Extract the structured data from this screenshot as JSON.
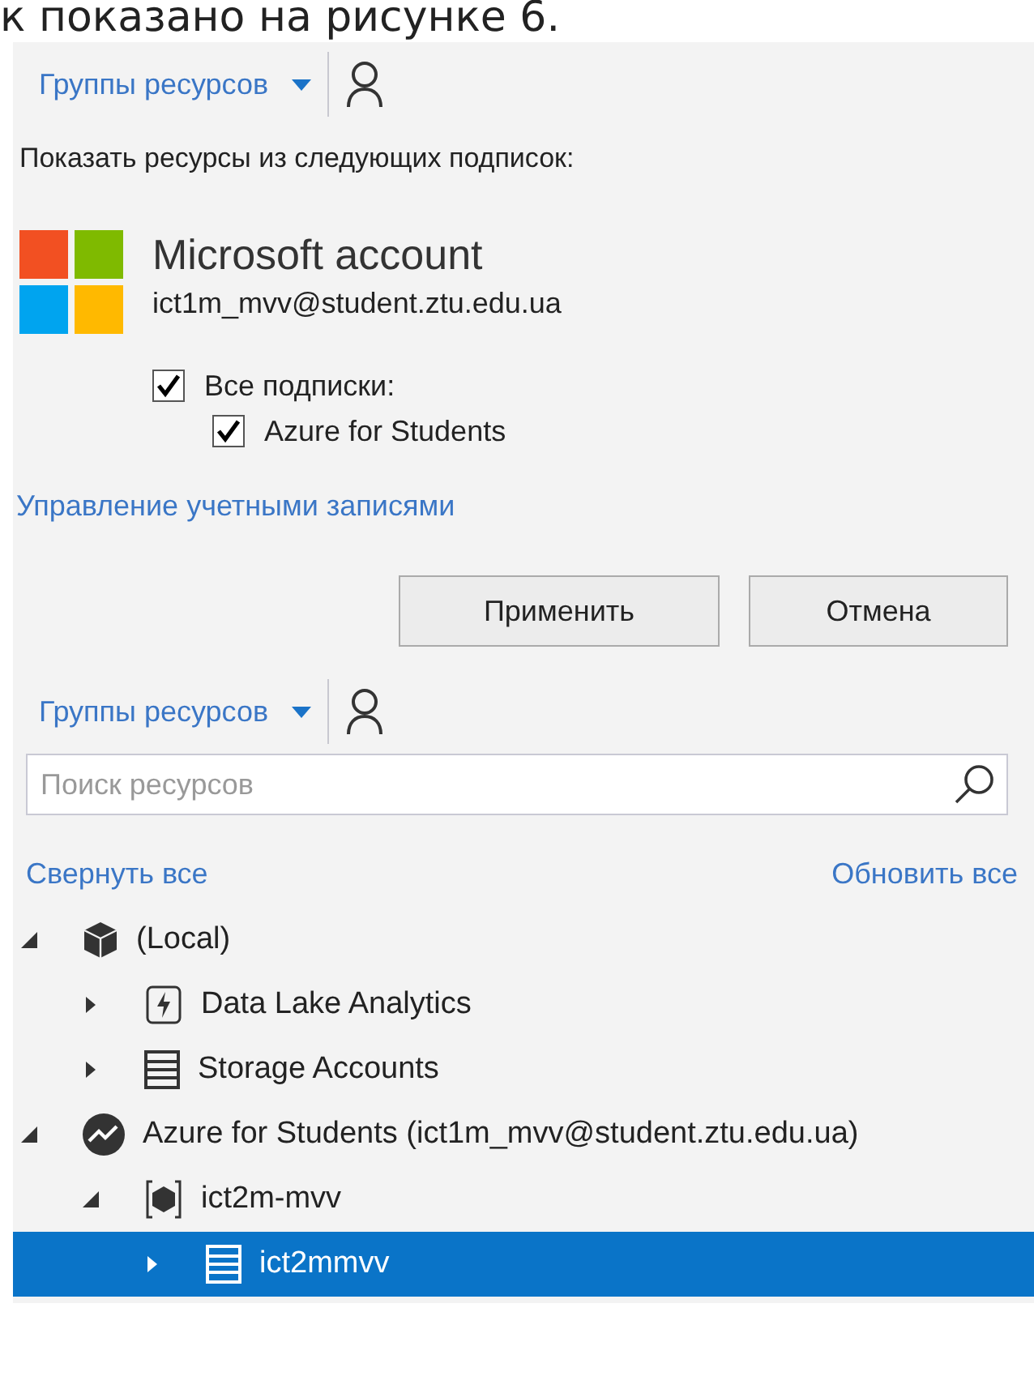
{
  "caption_fragment": "к показано на рисунке 6.",
  "filter_panel": {
    "toolbar": {
      "dropdown": "Группы ресурсов"
    },
    "prompt": "Показать ресурсы из следующих подписок:",
    "account": {
      "title": "Microsoft account",
      "email": "ict1m_mvv@student.ztu.edu.ua"
    },
    "checkboxes": [
      {
        "label": "Все подписки:",
        "checked": true
      },
      {
        "label": "Azure for Students",
        "checked": true
      }
    ],
    "manage_link": "Управление учетными записями",
    "buttons": [
      "Применить",
      "Отмена"
    ]
  },
  "explorer": {
    "toolbar": {
      "dropdown": "Группы ресурсов"
    },
    "search": {
      "placeholder": "Поиск ресурсов"
    },
    "collapse_link": "Свернуть все",
    "refresh_link": "Обновить все",
    "tree": [
      {
        "label": "(Local)",
        "kind": "cube",
        "expanded": true,
        "selected": false,
        "children": [
          {
            "label": "Data Lake Analytics",
            "kind": "analytics",
            "expanded": false,
            "selected": false
          },
          {
            "label": "Storage Accounts",
            "kind": "storage",
            "expanded": false,
            "selected": false
          }
        ]
      },
      {
        "label": "Azure for Students (ict1m_mvv@student.ztu.edu.ua)",
        "kind": "subscription",
        "expanded": true,
        "selected": false,
        "children": [
          {
            "label": "ict2m-mvv",
            "kind": "group",
            "expanded": true,
            "selected": false,
            "children": [
              {
                "label": "ict2mmvv",
                "kind": "storage",
                "expanded": false,
                "selected": true
              }
            ]
          }
        ]
      }
    ]
  }
}
